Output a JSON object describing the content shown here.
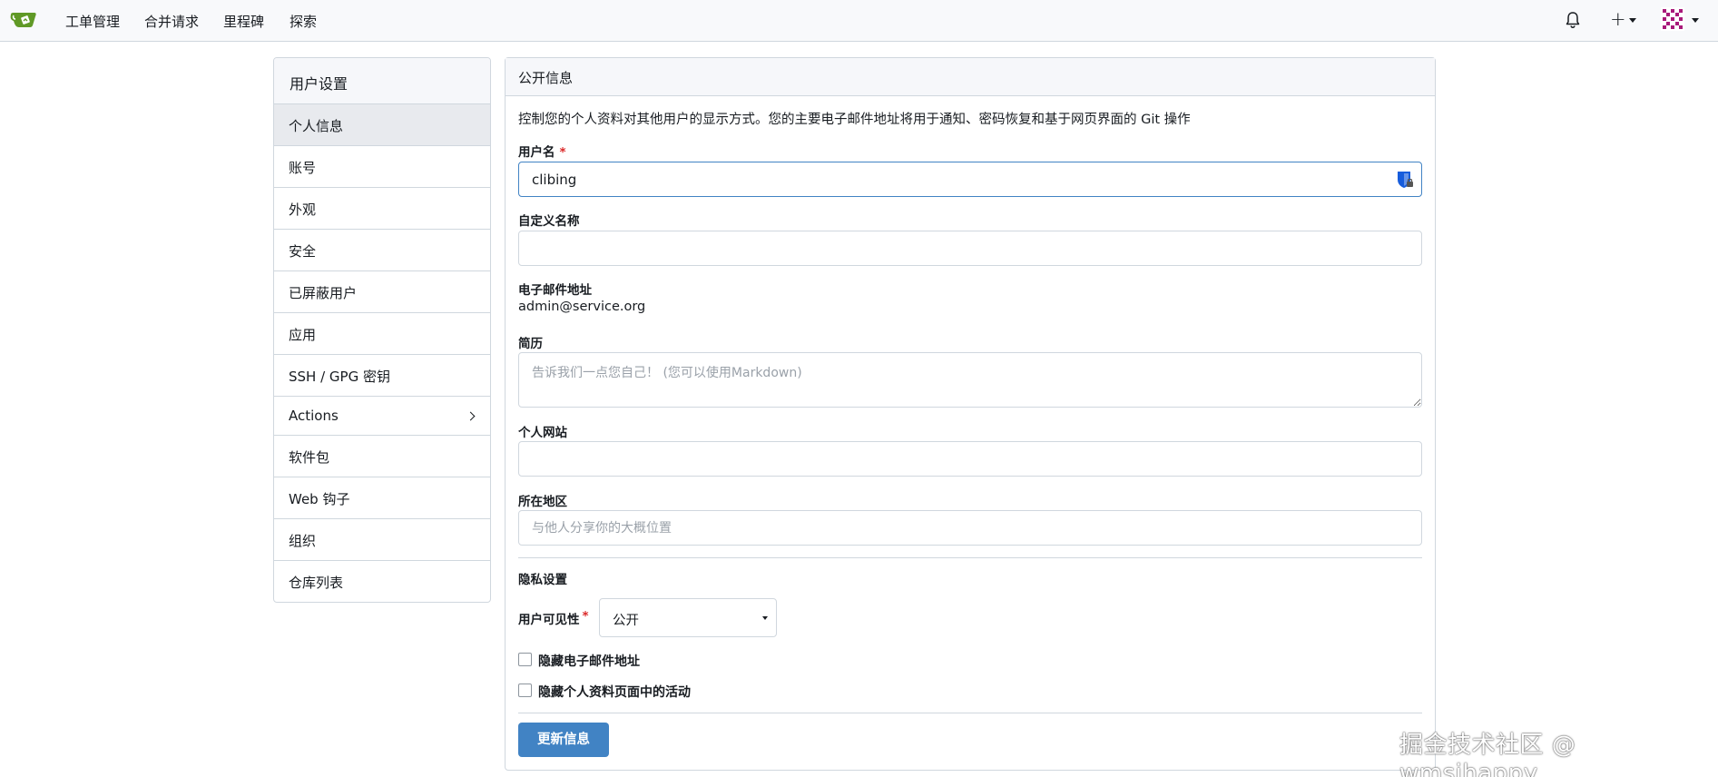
{
  "nav": {
    "items": [
      "工单管理",
      "合并请求",
      "里程碑",
      "探索"
    ],
    "plus_label": "+",
    "icons": [
      "gitea-logo-icon",
      "bell-icon",
      "plus-icon",
      "avatar"
    ]
  },
  "sidebar": {
    "title": "用户设置",
    "items": [
      {
        "label": "个人信息",
        "active": true
      },
      {
        "label": "账号"
      },
      {
        "label": "外观"
      },
      {
        "label": "安全"
      },
      {
        "label": "已屏蔽用户"
      },
      {
        "label": "应用"
      },
      {
        "label": "SSH / GPG 密钥"
      },
      {
        "label": "Actions",
        "has_submenu": true
      },
      {
        "label": "软件包"
      },
      {
        "label": "Web 钩子"
      },
      {
        "label": "组织"
      },
      {
        "label": "仓库列表"
      }
    ]
  },
  "panel": {
    "title": "公开信息",
    "description": "控制您的个人资料对其他用户的显示方式。您的主要电子邮件地址将用于通知、密码恢复和基于网页界面的 Git 操作",
    "username_label": "用户名",
    "username_value": "clibing",
    "fullname_label": "自定义名称",
    "fullname_value": "",
    "email_label": "电子邮件地址",
    "email_value": "admin@service.org",
    "bio_label": "简历",
    "bio_placeholder": "告诉我们一点您自己！ (您可以使用Markdown)",
    "website_label": "个人网站",
    "website_value": "",
    "location_label": "所在地区",
    "location_placeholder": "与他人分享你的大概位置",
    "privacy_title": "隐私设置",
    "visibility_label": "用户可见性",
    "visibility_value": "公开",
    "hide_email_label": "隐藏电子邮件地址",
    "hide_activity_label": "隐藏个人资料页面中的活动",
    "submit_label": "更新信息",
    "required_mark": "*"
  },
  "watermark": "掘金技术社区 @ wmsjhappy",
  "colors": {
    "accent": "#4183c4",
    "logo_green": "#609926",
    "required": "#db2828"
  }
}
